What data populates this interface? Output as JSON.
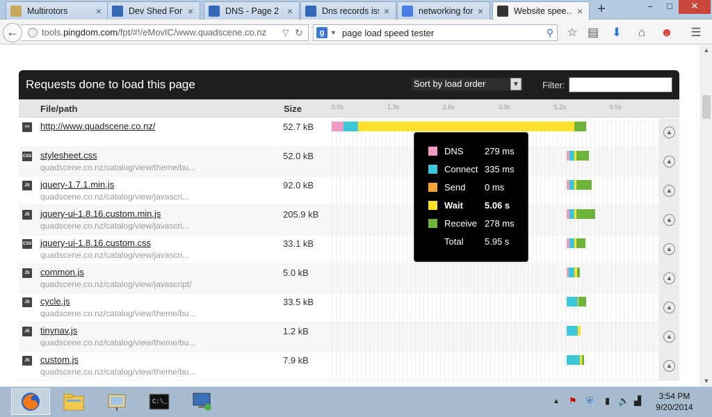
{
  "tabs": [
    {
      "label": "Multirotors",
      "icon": "folder-icon",
      "color": "#c9a85a"
    },
    {
      "label": "Dev Shed Forums",
      "icon": "forum-icon",
      "color": "#3568b6"
    },
    {
      "label": "DNS - Page 2",
      "icon": "forum-icon",
      "color": "#3568b6"
    },
    {
      "label": "Dns records issue",
      "icon": "forum-icon",
      "color": "#3568b6"
    },
    {
      "label": "networking foru...",
      "icon": "google-icon",
      "color": "#4a7fe0"
    },
    {
      "label": "Website spee...",
      "icon": "pingdom-icon",
      "color": "#333333",
      "active": true
    }
  ],
  "window_controls": {
    "minimize": "–",
    "maximize": "□",
    "close": "✕"
  },
  "nav": {
    "url_prefix": "tools.",
    "url_domain": "pingdom.com",
    "url_path": "/fpt/#!/eMovIC/www.quadscene.co.nz",
    "search_value": "page load speed tester"
  },
  "panel": {
    "title": "Requests done to load this page",
    "sort_label": "Sort by load order",
    "filter_label": "Filter:",
    "filter_value": ""
  },
  "columns": {
    "file": "File/path",
    "size": "Size",
    "ticks": [
      "0.0s",
      "1.3s",
      "2.6s",
      "3.9s",
      "5.2s",
      "6.5s"
    ]
  },
  "requests": [
    {
      "type": "HTML",
      "name": "http://www.quadscene.co.nz/",
      "path": "",
      "size": "52.7 kB",
      "timing": [
        0.0,
        0.279,
        0.335,
        0.0,
        5.06,
        0.278
      ]
    },
    {
      "type": "CSS",
      "name": "stylesheet.css",
      "path": "quadscene.co.nz/catalog/view/theme/bu...",
      "size": "52.0 kB",
      "timing": [
        5.5,
        0.06,
        0.12,
        0.0,
        0.04,
        0.3
      ]
    },
    {
      "type": "JS",
      "name": "jquery-1.7.1.min.js",
      "path": "quadscene.co.nz/catalog/view/javascri...",
      "size": "92.0 kB",
      "timing": [
        5.5,
        0.06,
        0.12,
        0.0,
        0.04,
        0.36
      ]
    },
    {
      "type": "JS",
      "name": "jquery-ui-1.8.16.custom.min.js",
      "path": "quadscene.co.nz/catalog/view/javascri...",
      "size": "205.9 kB",
      "timing": [
        5.5,
        0.06,
        0.12,
        0.0,
        0.04,
        0.45
      ]
    },
    {
      "type": "CSS",
      "name": "jquery-ui-1.8.16.custom.css",
      "path": "quadscene.co.nz/catalog/view/javascri...",
      "size": "33.1 kB",
      "timing": [
        5.5,
        0.06,
        0.12,
        0.0,
        0.04,
        0.22
      ]
    },
    {
      "type": "JS",
      "name": "common.js",
      "path": "quadscene.co.nz/catalog/view/javascript/",
      "size": "5.0 kB",
      "timing": [
        5.5,
        0.04,
        0.14,
        0.0,
        0.06,
        0.06
      ]
    },
    {
      "type": "JS",
      "name": "cycle.js",
      "path": "quadscene.co.nz/catalog/view/theme/bu...",
      "size": "33.5 kB",
      "timing": [
        5.5,
        0.0,
        0.26,
        0.0,
        0.02,
        0.17
      ]
    },
    {
      "type": "JS",
      "name": "tinynav.js",
      "path": "quadscene.co.nz/catalog/view/theme/bu...",
      "size": "1.2 kB",
      "timing": [
        5.5,
        0.0,
        0.26,
        0.0,
        0.06,
        0.0
      ]
    },
    {
      "type": "JS",
      "name": "custom.js",
      "path": "quadscene.co.nz/catalog/view/theme/bu...",
      "size": "7.9 kB",
      "timing": [
        5.5,
        0.0,
        0.3,
        0.0,
        0.05,
        0.05
      ]
    }
  ],
  "timing_colors": {
    "dns": "#f29ac4",
    "connect": "#3cc8d8",
    "send": "#f7a233",
    "wait": "#fde12d",
    "receive": "#6fb33a"
  },
  "tooltip": {
    "items": [
      {
        "label": "DNS",
        "value": "279 ms",
        "color": "#f29ac4"
      },
      {
        "label": "Connect",
        "value": "335 ms",
        "color": "#3cc8d8"
      },
      {
        "label": "Send",
        "value": "0 ms",
        "color": "#f7a233"
      },
      {
        "label": "Wait",
        "value": "5.06 s",
        "color": "#fde12d",
        "bold": true
      },
      {
        "label": "Receive",
        "value": "278 ms",
        "color": "#6fb33a"
      },
      {
        "label": "Total",
        "value": "5.95 s",
        "color": ""
      }
    ]
  },
  "taskbar": {
    "apps": [
      "firefox-icon",
      "file-explorer-icon",
      "presentation-icon",
      "command-prompt-icon",
      "remote-desktop-icon"
    ],
    "time": "3:54 PM",
    "date": "9/20/2014"
  }
}
